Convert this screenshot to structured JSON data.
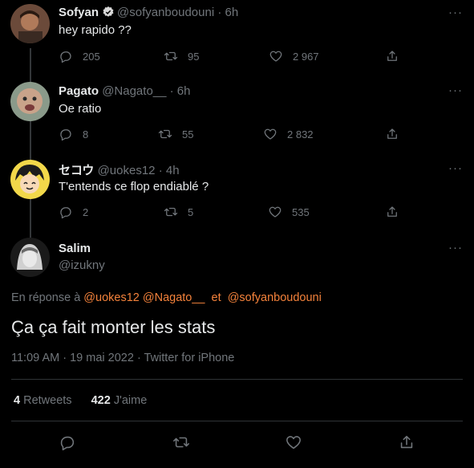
{
  "tweets": [
    {
      "name": "Sofyan",
      "handle": "@sofyanboudouni",
      "time": "· 6h",
      "verified": true,
      "text": "hey rapido ??",
      "replies": "205",
      "retweets": "95",
      "likes": "2 967"
    },
    {
      "name": "Pagato",
      "handle": "@Nagato__",
      "time": "· 6h",
      "text": "Oe ratio",
      "replies": "8",
      "retweets": "55",
      "likes": "2 832"
    },
    {
      "name": "セコウ",
      "handle": "@uokes12",
      "time": "· 4h",
      "text": "T'entends ce flop endiablé ?",
      "replies": "2",
      "retweets": "5",
      "likes": "535"
    }
  ],
  "main": {
    "name": "Salim",
    "handle": "@izukny",
    "reply_prefix": "En réponse à",
    "mention1": "@uokes12",
    "mention2": "@Nagato__",
    "reply_and": "et",
    "mention3": "@sofyanboudouni",
    "text": "Ça ça fait monter les stats",
    "time": "11:09 AM",
    "date": "· 19 mai 2022",
    "source": "· Twitter for iPhone",
    "retweet_count": "4",
    "retweet_label": "Retweets",
    "like_count": "422",
    "like_label": "J'aime"
  },
  "more_label": "···",
  "colors": {
    "accent": "#f4823b",
    "background": "#000000",
    "muted": "#71767b"
  }
}
